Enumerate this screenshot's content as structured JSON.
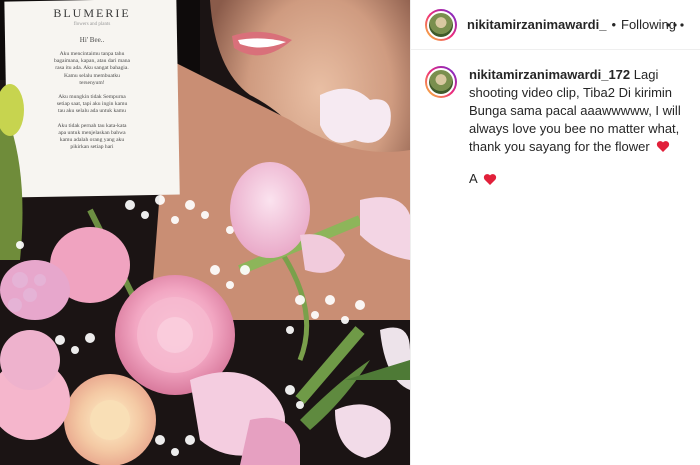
{
  "post": {
    "author": "nikitamirzanimawardi_",
    "follow_state": "Following",
    "separator": "•"
  },
  "card": {
    "brand": "BLUMERIE",
    "brand_sub": "flowers and plants",
    "greeting": "Hi' Bee..",
    "paragraph1": [
      "Aku mencintaimu tanpa tahu",
      "bagaimana, kapan, atau dari mana",
      "rasa itu ada. Aku sangat bahagia.",
      "Kamu selalu membuatku",
      "tersenyum!"
    ],
    "paragraph2": [
      "Aku mungkin tidak Sempurna",
      "setiap saat, tapi aku ingin kamu",
      "tau aku selalu ada untuk kamu"
    ],
    "paragraph3": [
      "Aku tidak pernah tau kata-kata",
      "apa untuk menjelaskan bahwa",
      "kamu adalah orang yang aku",
      "pikirkan setiap hari"
    ]
  },
  "caption": {
    "username": "nikitamirzanimawardi_172",
    "lines": [
      "Lagi",
      "shooting video clip, Tiba2 Di kirimin",
      "Bunga sama pacal aaawwwww, I will",
      "always love you bee no matter what,",
      "thank you sayang for the flower"
    ],
    "reply": "A"
  },
  "colors": {
    "heart": "#ed1c3a",
    "username": "#262626",
    "divider": "#efefef"
  },
  "icons": {
    "more": "more-options-icon",
    "heart": "heart-emoji"
  }
}
